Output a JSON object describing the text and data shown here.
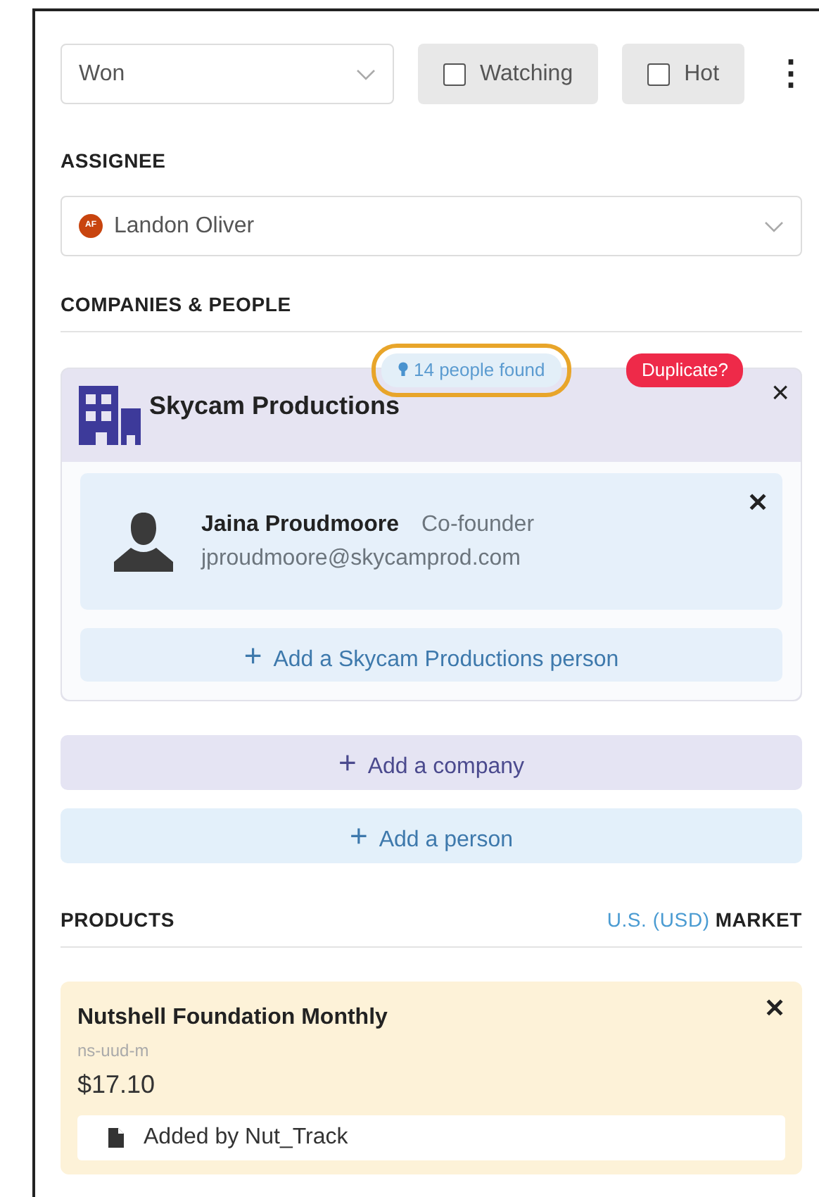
{
  "stage": {
    "value": "Won"
  },
  "toggles": [
    {
      "label": "Watching",
      "checked": false
    },
    {
      "label": "Hot",
      "checked": false
    }
  ],
  "more_menu": {
    "glyph": "⋮"
  },
  "assignee": {
    "heading": "ASSIGNEE",
    "initials": "AF",
    "value": "Landon Oliver"
  },
  "companies_heading": "COMPANIES & PEOPLE",
  "company": {
    "name": "Skycam Productions",
    "people_found": "14 people found",
    "people_found_highlighted": true,
    "duplicate_badge": "Duplicate?",
    "close": "×",
    "people": [
      {
        "name": "Jaina Proudmoore",
        "role": "Co-founder",
        "email": "jproudmoore@skycamprod.com",
        "close": "✕"
      }
    ],
    "add_person": {
      "icon": "+",
      "label": "Add a Skycam Productions person"
    }
  },
  "add_buttons": [
    {
      "kind": "company",
      "icon": "+",
      "label": "Add a company"
    },
    {
      "kind": "person",
      "icon": "+",
      "label": "Add a person"
    }
  ],
  "products": {
    "heading": "PRODUCTS",
    "market_link": "U.S. (USD)",
    "market_label": "MARKET",
    "items": [
      {
        "name": "Nutshell Foundation Monthly",
        "sku": "ns-uud-m",
        "price": "$17.10",
        "note": "Added by Nut_Track",
        "close": "✕"
      }
    ]
  }
}
